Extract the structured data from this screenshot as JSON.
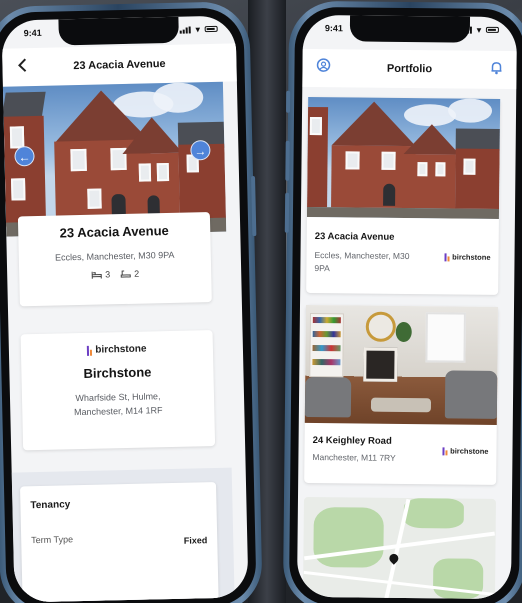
{
  "left_phone": {
    "status_time": "9:41",
    "nav_title": "23 Acacia Avenue",
    "property": {
      "title": "23 Acacia Avenue",
      "address": "Eccles, Manchester, M30 9PA",
      "bedrooms": "3",
      "bathrooms": "2"
    },
    "agent": {
      "logo_text": "birchstone",
      "name": "Birchstone",
      "address_line1": "Wharfside St, Hulme,",
      "address_line2": "Manchester, M14 1RF"
    },
    "tenancy": {
      "heading": "Tenancy",
      "term_label": "Term Type",
      "term_value": "Fixed"
    }
  },
  "right_phone": {
    "status_time": "9:41",
    "nav_title": "Portfolio",
    "properties": [
      {
        "title": "23 Acacia Avenue",
        "address_line1": "Eccles, Manchester, M30",
        "address_line2": "9PA",
        "agent_logo": "birchstone"
      },
      {
        "title": "24 Keighley Road",
        "address_line1": "Manchester, M11 7RY",
        "agent_logo": "birchstone"
      }
    ]
  },
  "colors": {
    "accent_blue": "#4f84d9",
    "logo_purple": "#6c3fc4",
    "logo_orange": "#f08a3a"
  },
  "icons": {
    "back": "chevron-left-icon",
    "prev": "arrow-left-icon",
    "next": "arrow-right-icon",
    "bed": "bed-icon",
    "bath": "bath-icon",
    "profile": "user-circle-icon",
    "notifications": "bell-icon",
    "map_marker": "map-pin-icon"
  }
}
